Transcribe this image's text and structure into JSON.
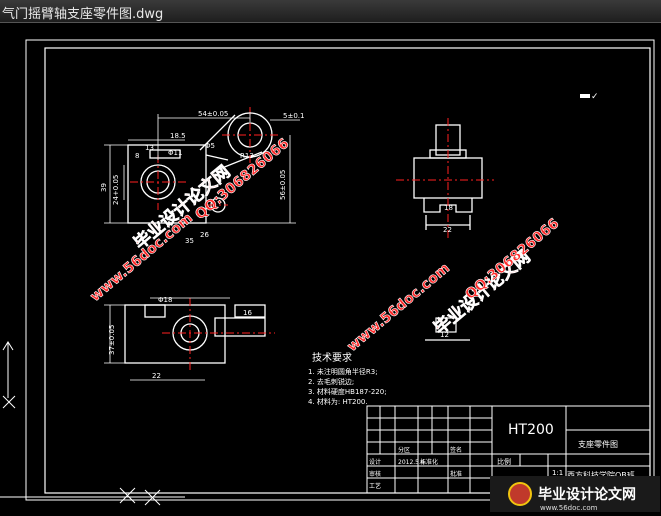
{
  "window": {
    "title": "气门摇臂轴支座零件图.dwg"
  },
  "colors": {
    "background": "#000000",
    "line": "#ffffff",
    "center": "#ff2020",
    "dim": "#ffffff",
    "watermark": "#ff2a2a"
  },
  "drawing": {
    "front_view": {
      "dims": [
        "54±0.05",
        "18.5",
        "5±0.1",
        "8",
        "13",
        "26",
        "56±0.05",
        "39",
        "Φ11",
        "Φ5",
        "35",
        "R13",
        "R2",
        "24+0.05",
        "Φ16",
        "2×"
      ]
    },
    "side_view": {
      "dims": [
        "18",
        "22"
      ]
    },
    "bottom_view": {
      "dims": [
        "Φ18",
        "22",
        "37±0.05",
        "4.14",
        "16",
        "15",
        "54",
        "12",
        "60"
      ]
    },
    "notes": {
      "title": "技术要求",
      "items": [
        "1. 未注明圆角半径R3;",
        "2. 去毛刺锐边;",
        "3. 材料硬度HB187-220;",
        "4. 材料为: HT200."
      ]
    },
    "title_block": {
      "material": "HT200",
      "part_name": "支座零件图",
      "school": "西方科技学院OB班",
      "scale": "1:1",
      "date": "2012.5.4",
      "ratio_label": "比例",
      "design_label": "设计",
      "check_label": "审核",
      "approve_label": "批准",
      "drawn_label": "标准化",
      "process_label": "工艺",
      "sign_label": "签名",
      "date_label": "日期",
      "zone_label": "分区",
      "count_label": "数量",
      "weight_label": "重量"
    },
    "mark": "✓"
  },
  "watermarks": {
    "brand": "毕业设计论文网",
    "qq": "QQ:306826066",
    "site": "www.56doc.com",
    "logo_text": "毕业设计论文网",
    "logo_url": "www.56doc.com"
  }
}
